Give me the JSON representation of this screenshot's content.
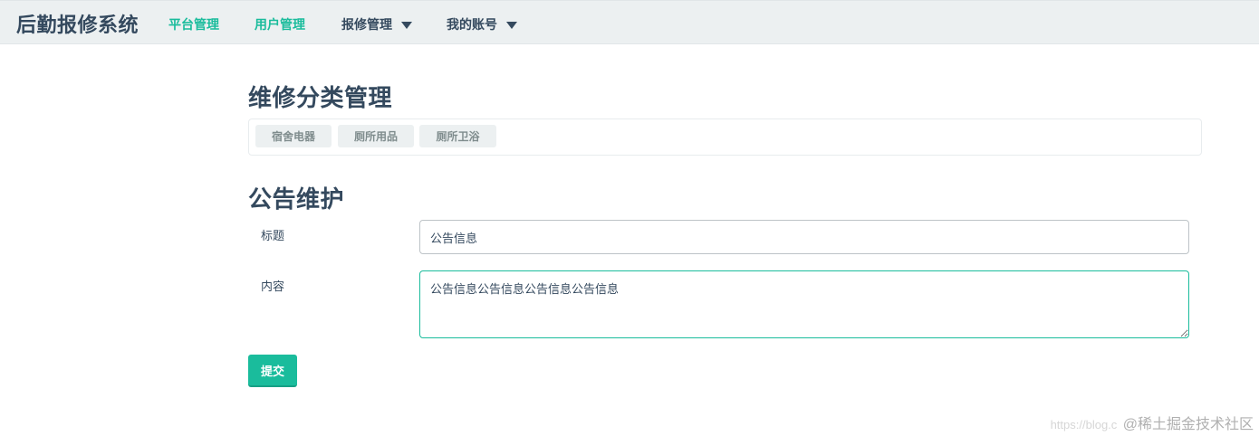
{
  "navbar": {
    "brand": "后勤报修系统",
    "items": [
      {
        "label": "平台管理",
        "active": true
      },
      {
        "label": "用户管理",
        "active": true
      },
      {
        "label": "报修管理",
        "dropdown": true
      },
      {
        "label": "我的账号",
        "dropdown": true
      }
    ]
  },
  "category_section": {
    "title": "维修分类管理",
    "categories": [
      "宿舍电器",
      "厕所用品",
      "厕所卫浴"
    ]
  },
  "notice_section": {
    "title": "公告维护",
    "title_label": "标题",
    "title_value": "公告信息",
    "content_label": "内容",
    "content_value": "公告信息公告信息公告信息公告信息",
    "submit_label": "提交"
  },
  "watermark": {
    "url": "https://blog.c",
    "name": "@稀土掘金技术社区"
  },
  "colors": {
    "accent": "#1abc9c",
    "text": "#34495e",
    "navbar_bg": "#ecf0f1"
  }
}
